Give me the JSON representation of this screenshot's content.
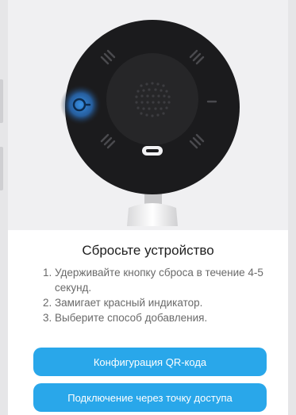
{
  "screen": {
    "title": "Сбросьте устройство",
    "steps": [
      {
        "num": "1.",
        "text": "Удерживайте кнопку сброса в течение 4-5 секунд."
      },
      {
        "num": "2.",
        "text": "Замигает красный индикатор."
      },
      {
        "num": "3.",
        "text": "Выберите способ добавления."
      }
    ],
    "buttons": {
      "qr_config": "Конфигурация QR-кода",
      "ap_connect": "Подключение через точку доступа"
    }
  },
  "colors": {
    "accent": "#29a7ea",
    "camera_body": "#1b1b1d",
    "reset_glow": "#2f86e0"
  },
  "icons": {
    "reset_button": "reset-button-icon",
    "speaker": "speaker-grille-icon",
    "usb_port": "usb-port-icon"
  }
}
